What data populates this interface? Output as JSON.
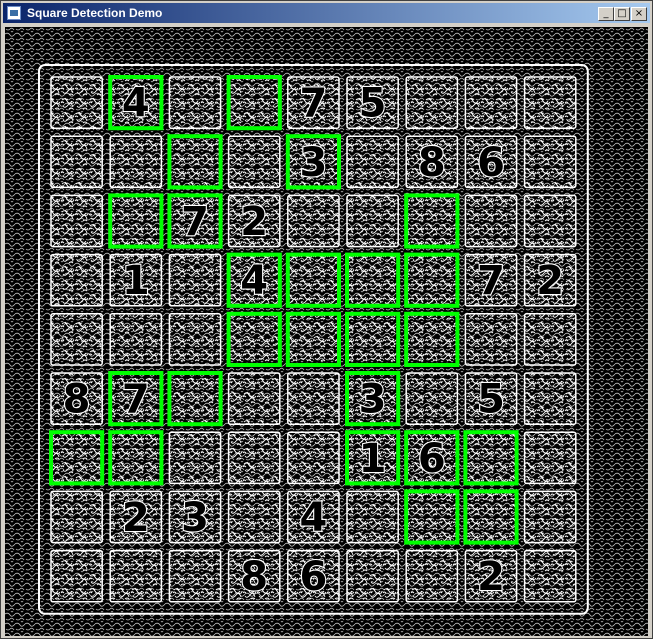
{
  "window": {
    "title": "Square Detection Demo",
    "buttons": {
      "minimize_glyph": "_",
      "maximize_glyph": "□",
      "close_glyph": "×"
    }
  },
  "board": {
    "rows": 9,
    "cols": 9,
    "digits": [
      [
        "",
        "4",
        "",
        "",
        "7",
        "5",
        "",
        "",
        ""
      ],
      [
        "",
        "",
        "",
        "",
        "3",
        "",
        "8",
        "6",
        ""
      ],
      [
        "",
        "",
        "7",
        "2",
        "",
        "",
        "",
        "",
        ""
      ],
      [
        "",
        "1",
        "",
        "4",
        "",
        "",
        "",
        "7",
        "2"
      ],
      [
        "",
        "",
        "",
        "",
        "",
        "",
        "",
        "",
        ""
      ],
      [
        "8",
        "7",
        "",
        "",
        "",
        "3",
        "",
        "5",
        ""
      ],
      [
        "",
        "",
        "",
        "",
        "",
        "1",
        "6",
        "",
        ""
      ],
      [
        "",
        "2",
        "3",
        "",
        "4",
        "",
        "",
        "",
        ""
      ],
      [
        "",
        "",
        "",
        "8",
        "6",
        "",
        "",
        "2",
        ""
      ]
    ],
    "detected_squares": [
      [
        0,
        1
      ],
      [
        0,
        3
      ],
      [
        1,
        2
      ],
      [
        1,
        4
      ],
      [
        2,
        1
      ],
      [
        2,
        2
      ],
      [
        2,
        6
      ],
      [
        3,
        3
      ],
      [
        3,
        4
      ],
      [
        3,
        5
      ],
      [
        3,
        6
      ],
      [
        4,
        3
      ],
      [
        4,
        4
      ],
      [
        4,
        5
      ],
      [
        4,
        6
      ],
      [
        5,
        1
      ],
      [
        5,
        2
      ],
      [
        5,
        5
      ],
      [
        6,
        0
      ],
      [
        6,
        1
      ],
      [
        6,
        5
      ],
      [
        6,
        6
      ],
      [
        6,
        7
      ],
      [
        7,
        6
      ],
      [
        7,
        7
      ]
    ],
    "colors": {
      "background": "#000000",
      "edge": "#ffffff",
      "detection": "#00ff00"
    }
  }
}
